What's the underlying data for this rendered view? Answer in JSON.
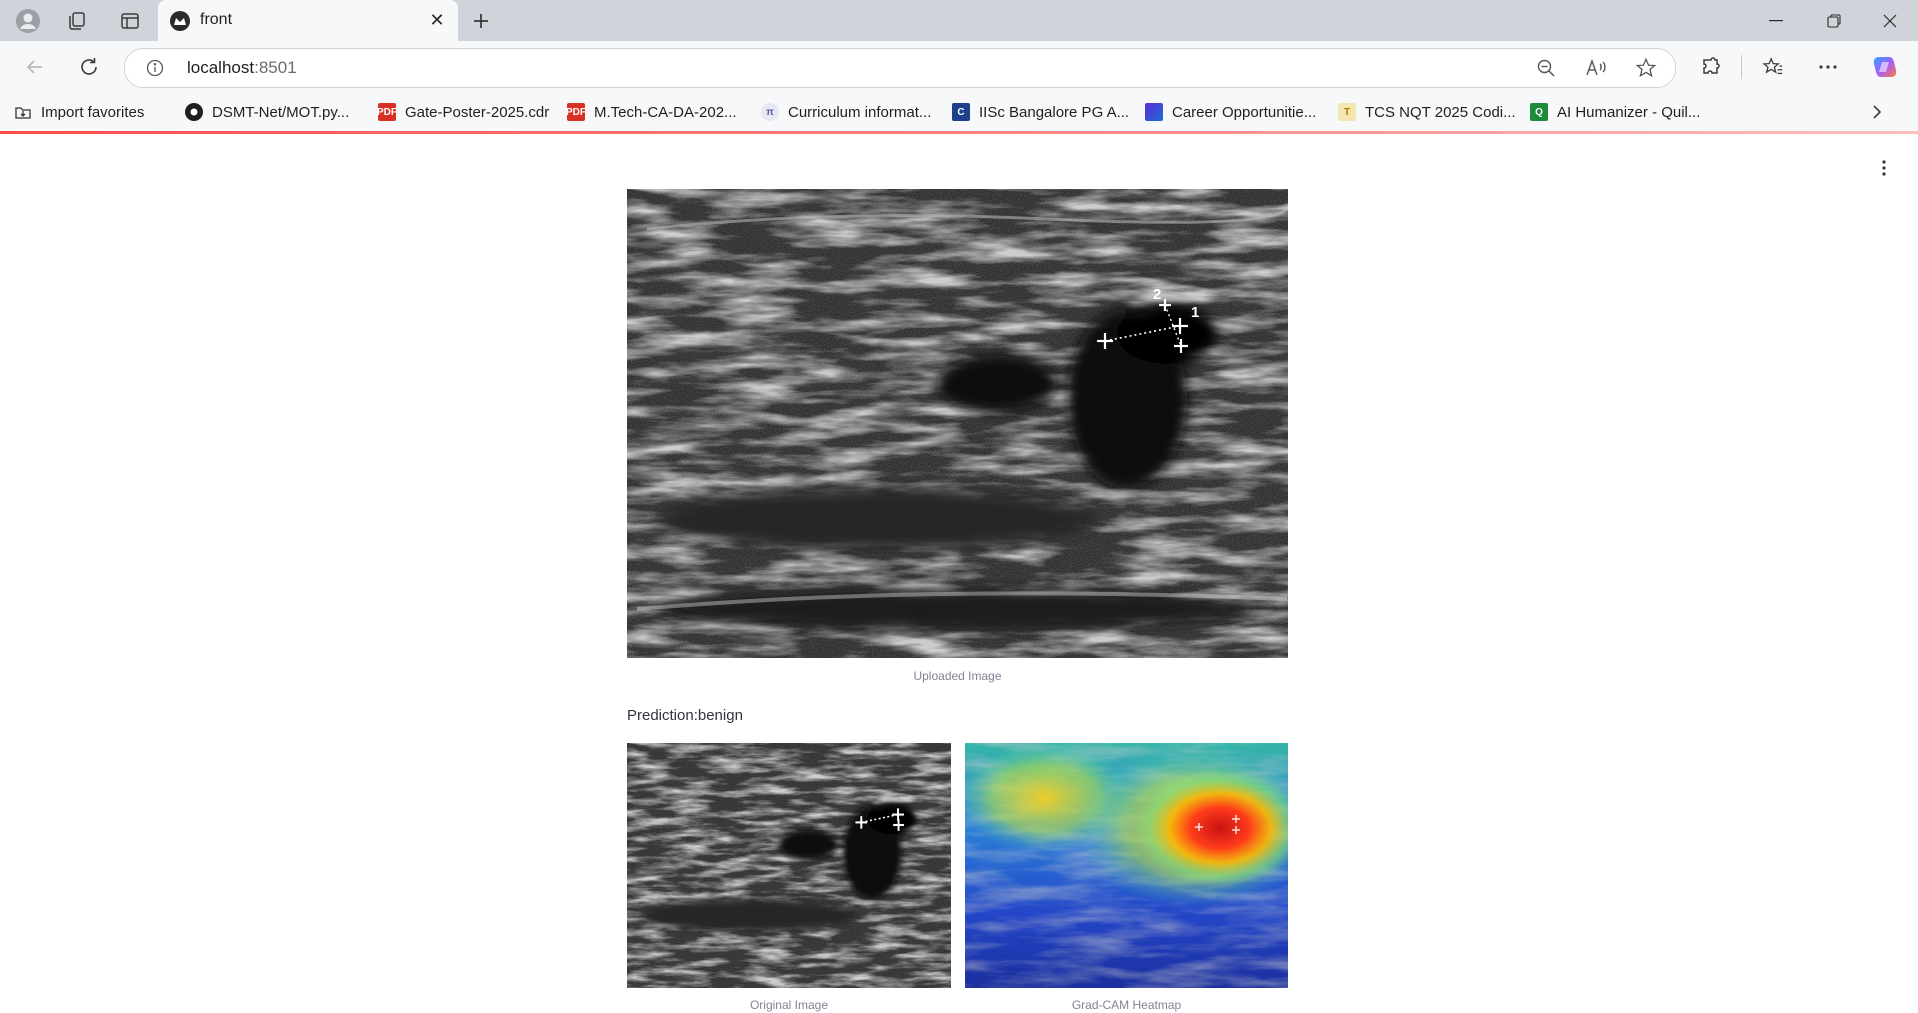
{
  "browser": {
    "tab": {
      "title": "front"
    },
    "address": {
      "host": "localhost",
      "port": ":8501"
    },
    "favorites": [
      {
        "label": "Import favorites",
        "icon": "import-icon"
      },
      {
        "label": "DSMT-Net/MOT.py...",
        "icon": "github-icon"
      },
      {
        "label": "Gate-Poster-2025.cdr",
        "icon": "pdf-icon"
      },
      {
        "label": "M.Tech-CA-DA-202...",
        "icon": "pdf-icon"
      },
      {
        "label": "Curriculum informat...",
        "icon": "curriculum-icon"
      },
      {
        "label": "IISc Bangalore PG A...",
        "icon": "c-icon"
      },
      {
        "label": "Career Opportunitie...",
        "icon": "career-icon"
      },
      {
        "label": "TCS NQT 2025 Codi...",
        "icon": "tcs-icon"
      },
      {
        "label": "AI Humanizer - Quil...",
        "icon": "quillbot-icon"
      }
    ]
  },
  "app": {
    "uploaded_caption": "Uploaded Image",
    "prediction": "Prediction:benign",
    "original_caption": "Original Image",
    "gradcam_caption": "Grad-CAM Heatmap",
    "markers": [
      "1",
      "2"
    ]
  },
  "colors": {
    "accent": "#ff4b4b",
    "caption": "#808495",
    "text": "#31333f"
  }
}
